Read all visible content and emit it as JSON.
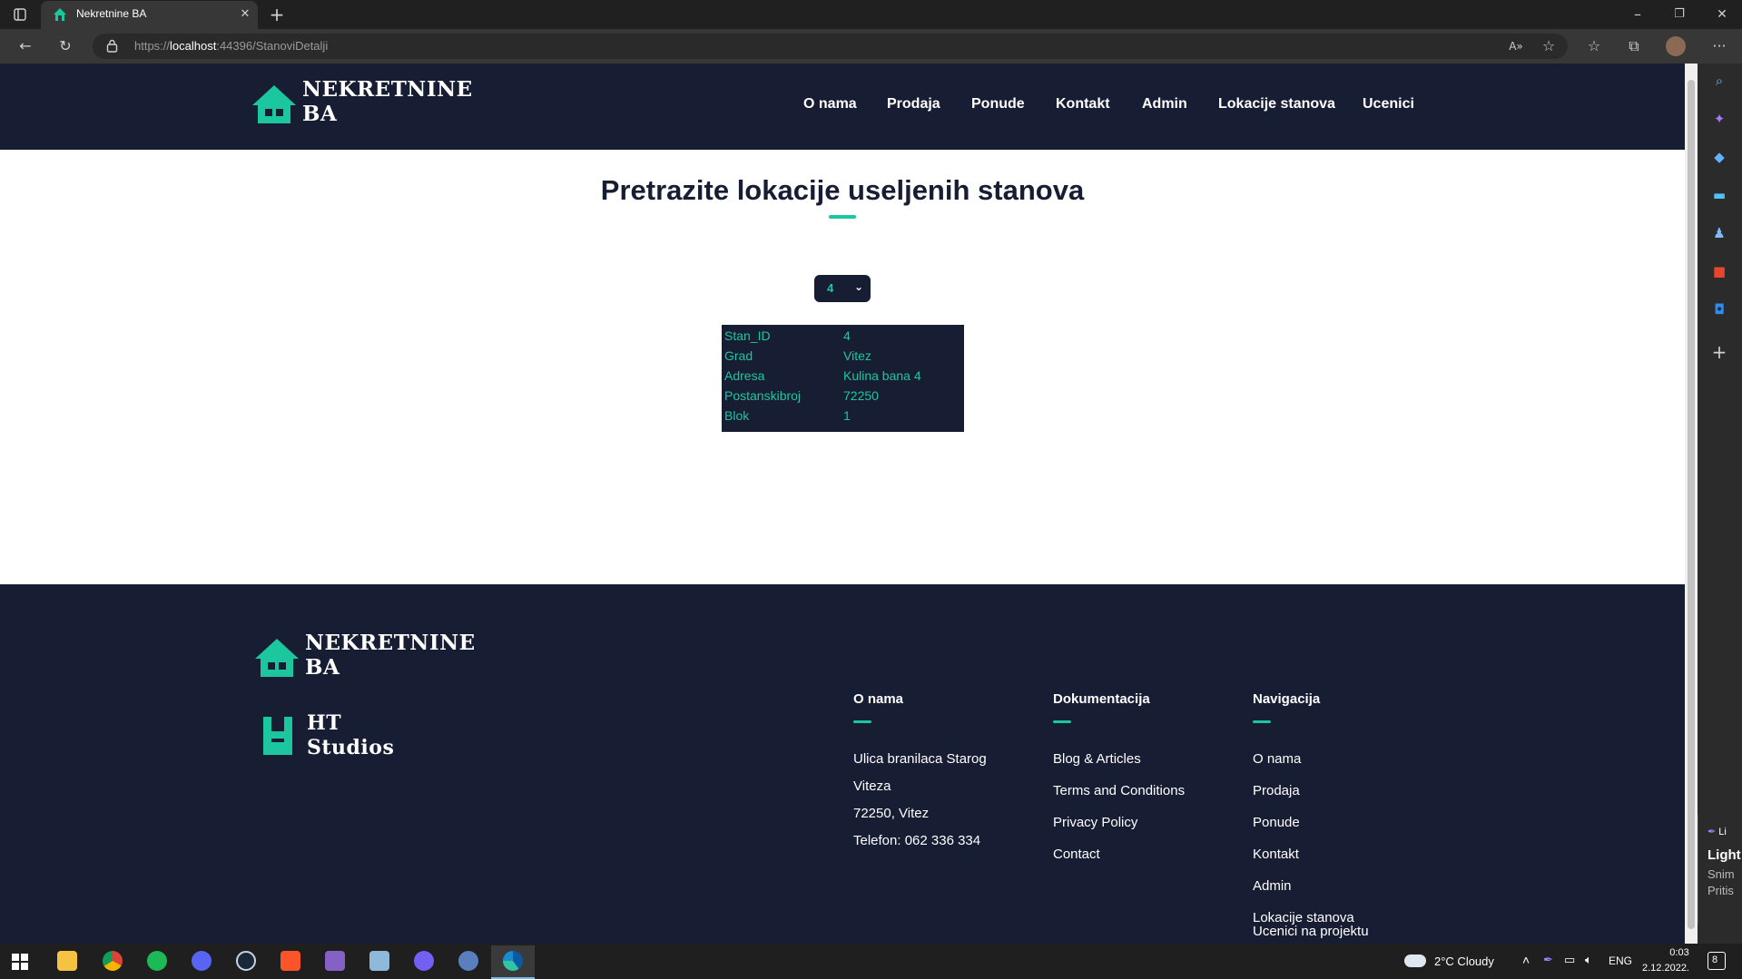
{
  "browser": {
    "tab_title": "Nekretnine BA",
    "url_scheme": "https://",
    "url_host": "localhost",
    "url_rest": ":44396/StanoviDetalji"
  },
  "header": {
    "logo_line1": "NEKRETNINE",
    "logo_line2": "BA",
    "nav": [
      "O nama",
      "Prodaja",
      "Ponude",
      "Kontakt",
      "Admin",
      "Lokacije stanova",
      "Ucenici"
    ]
  },
  "main": {
    "title": "Pretrazite lokacije useljenih stanova",
    "select_value": "4",
    "details": [
      {
        "label": "Stan_ID",
        "value": "4"
      },
      {
        "label": "Grad",
        "value": "Vitez"
      },
      {
        "label": "Adresa",
        "value": "Kulina bana 4"
      },
      {
        "label": "Postanskibroj",
        "value": "72250"
      },
      {
        "label": "Blok",
        "value": "1"
      }
    ]
  },
  "footer": {
    "logo_line1": "NEKRETNINE",
    "logo_line2": "BA",
    "studio_line1": "HT",
    "studio_line2": "Studios",
    "about": {
      "heading": "O nama",
      "lines": [
        "Ulica branilaca Starog",
        "Viteza",
        "72250, Vitez",
        "Telefon: 062 336 334"
      ]
    },
    "docs": {
      "heading": "Dokumentacija",
      "links": [
        "Blog & Articles",
        "Terms and Conditions",
        "Privacy Policy",
        "Contact"
      ]
    },
    "navigation": {
      "heading": "Navigacija",
      "links": [
        "O nama",
        "Prodaja",
        "Ponude",
        "Kontakt",
        "Admin",
        "Lokacije stanova",
        "Ucenici na projektu"
      ]
    }
  },
  "toast": {
    "line1": "Li",
    "line2": "Light",
    "line3": "Snim",
    "line4": "Pritis"
  },
  "taskbar": {
    "weather": "2°C  Cloudy",
    "language": "ENG",
    "time": "0:03",
    "date": "2.12.2022.",
    "notifications": "8"
  },
  "colors": {
    "navy": "#171d33",
    "accent": "#1cc7a0"
  }
}
